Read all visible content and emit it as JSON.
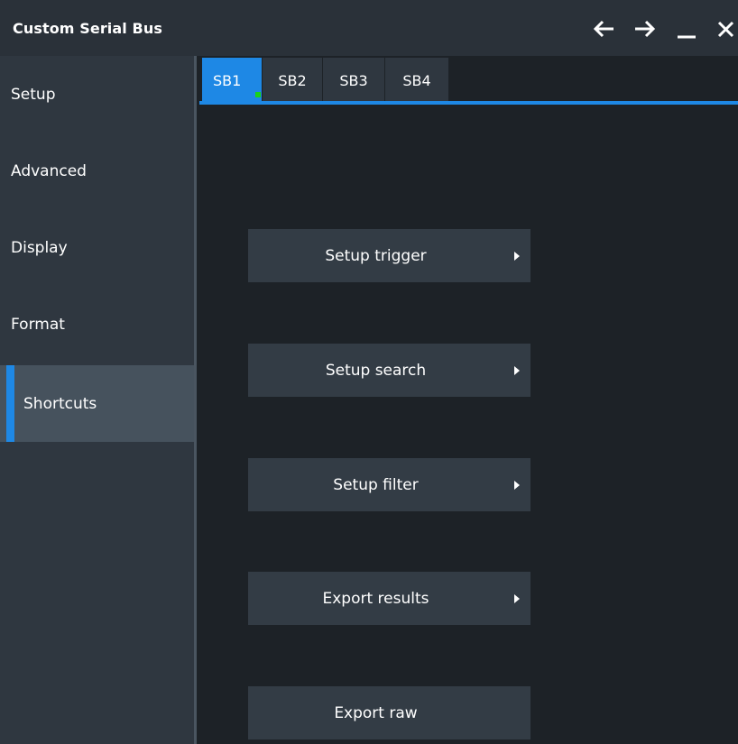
{
  "window": {
    "title": "Custom Serial Bus"
  },
  "titlebar_buttons": [
    {
      "icon": "arrow-left-icon"
    },
    {
      "icon": "arrow-right-icon"
    },
    {
      "icon": "minimize-icon"
    },
    {
      "icon": "close-icon"
    }
  ],
  "sidebar": {
    "items": [
      {
        "label": "Setup",
        "active": false
      },
      {
        "label": "Advanced",
        "active": false
      },
      {
        "label": "Display",
        "active": false
      },
      {
        "label": "Format",
        "active": false
      },
      {
        "label": "Shortcuts",
        "active": true
      }
    ]
  },
  "tabs": [
    {
      "label": "SB1",
      "active": true,
      "status": "enabled"
    },
    {
      "label": "SB2",
      "active": false
    },
    {
      "label": "SB3",
      "active": false
    },
    {
      "label": "SB4",
      "active": false
    }
  ],
  "shortcuts": [
    {
      "label": "Setup trigger",
      "has_arrow": true
    },
    {
      "label": "Setup search",
      "has_arrow": true
    },
    {
      "label": "Setup filter",
      "has_arrow": true
    },
    {
      "label": "Export results",
      "has_arrow": true
    },
    {
      "label": "Export raw",
      "has_arrow": false
    }
  ],
  "colors": {
    "accent": "#1e88e5",
    "status_on": "#19d219",
    "background": "#1d2227",
    "panel": "#2f3740"
  }
}
